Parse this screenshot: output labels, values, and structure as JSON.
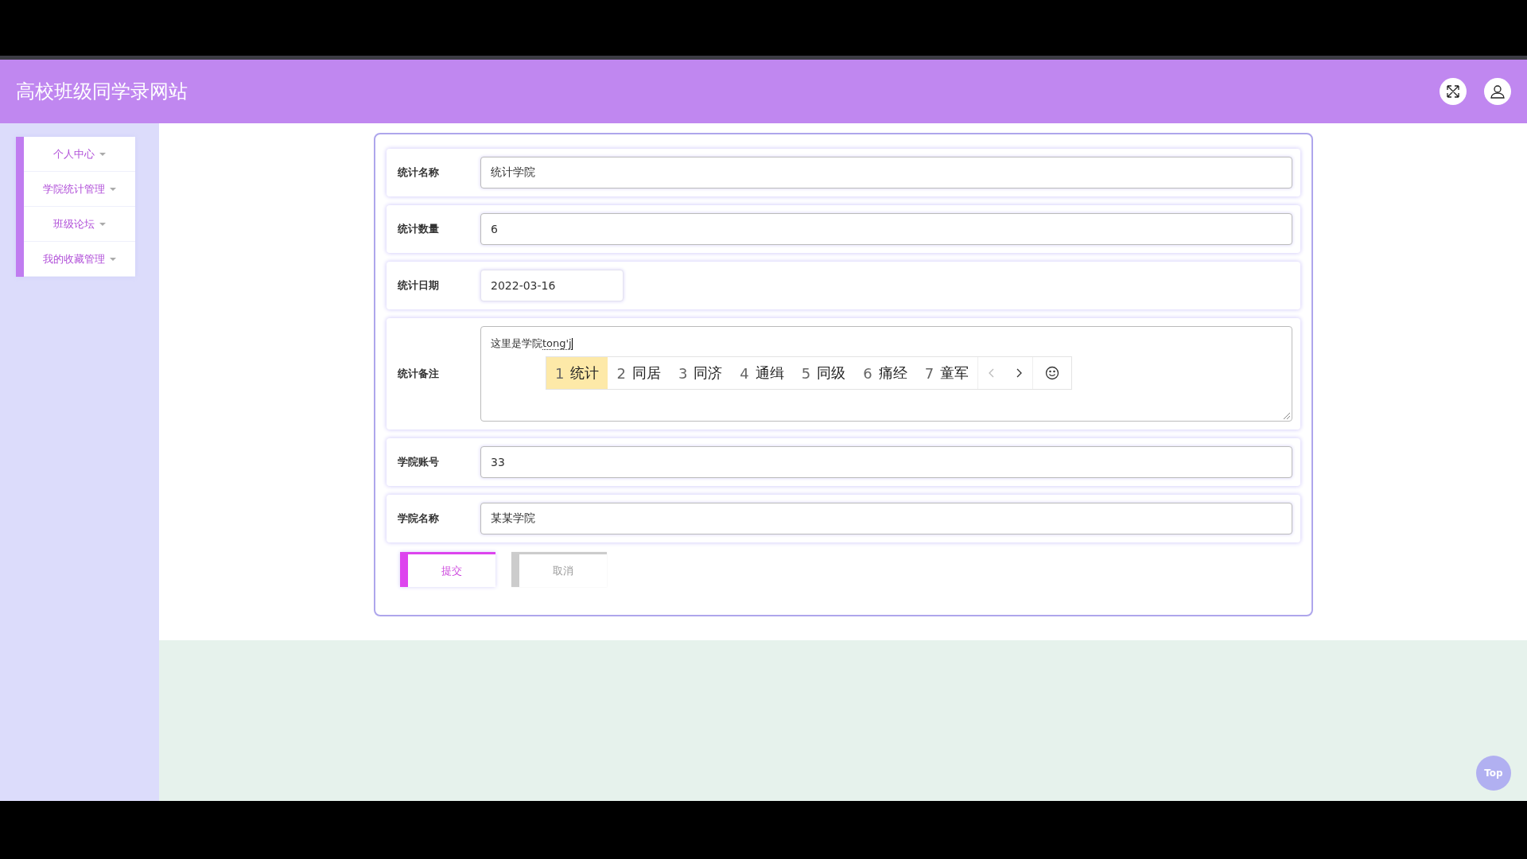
{
  "header": {
    "title": "高校班级同学录网站"
  },
  "sidebar": {
    "items": [
      {
        "label": "个人中心"
      },
      {
        "label": "学院统计管理"
      },
      {
        "label": "班级论坛"
      },
      {
        "label": "我的收藏管理"
      }
    ]
  },
  "form": {
    "fields": [
      {
        "kind": "input",
        "label": "统计名称",
        "value": "统计学院"
      },
      {
        "kind": "input",
        "label": "统计数量",
        "value": "6"
      },
      {
        "kind": "date",
        "label": "统计日期",
        "value": "2022-03-16"
      },
      {
        "kind": "textarea",
        "label": "统计备注",
        "value": "这里是学院",
        "composition": "tong'j"
      },
      {
        "kind": "input",
        "label": "学院账号",
        "value": "33"
      },
      {
        "kind": "input",
        "label": "学院名称",
        "value": "某某学院"
      }
    ],
    "buttons": [
      {
        "kind": "primary",
        "label": "提交"
      },
      {
        "kind": "secondary",
        "label": "取消"
      }
    ]
  },
  "ime": {
    "candidates": [
      {
        "index": "1",
        "text": "统计",
        "selected": true
      },
      {
        "index": "2",
        "text": "同居",
        "selected": false
      },
      {
        "index": "3",
        "text": "同济",
        "selected": false
      },
      {
        "index": "4",
        "text": "通缉",
        "selected": false
      },
      {
        "index": "5",
        "text": "同级",
        "selected": false
      },
      {
        "index": "6",
        "text": "痛经",
        "selected": false
      },
      {
        "index": "7",
        "text": "童军",
        "selected": false
      }
    ]
  },
  "top_button": {
    "label": "Top"
  }
}
